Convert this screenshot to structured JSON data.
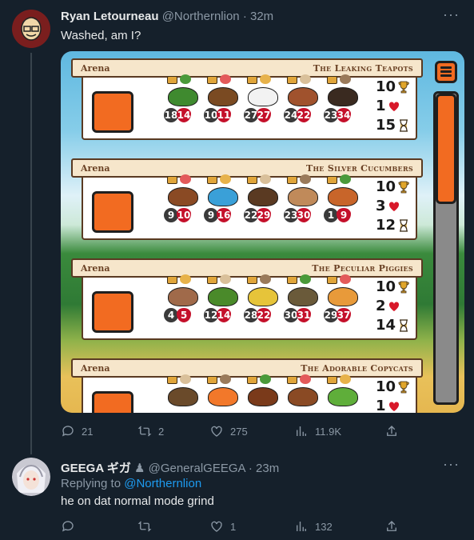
{
  "tweet1": {
    "name": "Ryan Letourneau",
    "handle": "@Northernlion",
    "time": "· 32m",
    "text": "Washed, am I?",
    "replies": "21",
    "retweets": "2",
    "likes": "275",
    "views": "11.9K"
  },
  "game": {
    "cards": [
      {
        "arena": "Arena",
        "team": "The Leaking Teapots",
        "pets": [
          {
            "attack": "18",
            "health": "14"
          },
          {
            "attack": "10",
            "health": "11"
          },
          {
            "attack": "27",
            "health": "27"
          },
          {
            "attack": "24",
            "health": "22"
          },
          {
            "attack": "23",
            "health": "34"
          }
        ],
        "wins": "10",
        "lives": "1",
        "turn": "15"
      },
      {
        "arena": "Arena",
        "team": "The Silver Cucumbers",
        "pets": [
          {
            "attack": "9",
            "health": "10"
          },
          {
            "attack": "9",
            "health": "16"
          },
          {
            "attack": "22",
            "health": "29"
          },
          {
            "attack": "23",
            "health": "30"
          },
          {
            "attack": "1",
            "health": "9"
          }
        ],
        "wins": "10",
        "lives": "3",
        "turn": "12"
      },
      {
        "arena": "Arena",
        "team": "The Peculiar Piggies",
        "pets": [
          {
            "attack": "4",
            "health": "5"
          },
          {
            "attack": "12",
            "health": "14"
          },
          {
            "attack": "28",
            "health": "22"
          },
          {
            "attack": "30",
            "health": "31"
          },
          {
            "attack": "29",
            "health": "37"
          }
        ],
        "wins": "10",
        "lives": "2",
        "turn": "14"
      },
      {
        "arena": "Arena",
        "team": "The Adorable Copycats",
        "wins": "10",
        "lives": "1"
      }
    ]
  },
  "tweet2": {
    "name": "GEEGA ギガ",
    "handle": "@GeneralGEEGA",
    "time": "· 23m",
    "replying_prefix": "Replying to ",
    "replying_handle": "@Northernlion",
    "text": "he on dat normal mode grind",
    "replies": "",
    "retweets": "",
    "likes": "1",
    "views": "132"
  },
  "colors": {
    "background": "#15202b",
    "text": "#e7e9ea",
    "muted": "#8b98a5",
    "link": "#1d9bf0",
    "game_orange": "#f26b21"
  },
  "icons": [
    "reply-icon",
    "retweet-icon",
    "like-icon",
    "views-icon",
    "share-icon",
    "more-icon",
    "trophy-icon",
    "heart-icon",
    "hourglass-icon",
    "menu-icon"
  ]
}
